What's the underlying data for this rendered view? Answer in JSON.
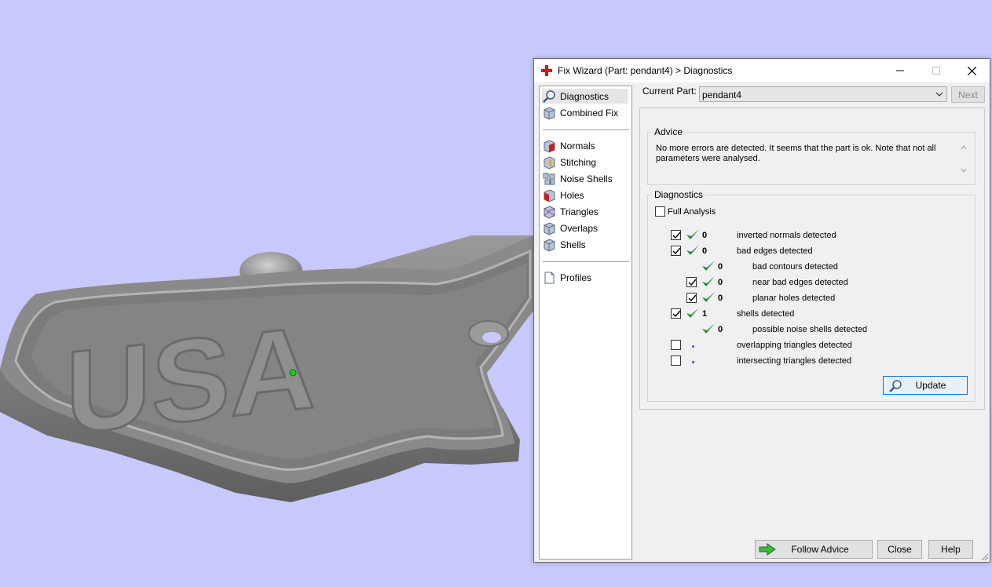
{
  "window": {
    "title": "Fix Wizard (Part: pendant4) > Diagnostics"
  },
  "viewport": {
    "model_text": "USA"
  },
  "nav": {
    "items": [
      {
        "label": "Diagnostics",
        "icon": "magnifier-icon"
      },
      {
        "label": "Combined Fix",
        "icon": "cube-icon"
      },
      {
        "label": "Normals",
        "icon": "normals-cube-icon"
      },
      {
        "label": "Stitching",
        "icon": "stitching-cube-icon"
      },
      {
        "label": "Noise Shells",
        "icon": "noise-shells-icon"
      },
      {
        "label": "Holes",
        "icon": "holes-cube-icon"
      },
      {
        "label": "Triangles",
        "icon": "triangles-cube-icon"
      },
      {
        "label": "Overlaps",
        "icon": "overlaps-cube-icon"
      },
      {
        "label": "Shells",
        "icon": "shells-cube-icon"
      },
      {
        "label": "Profiles",
        "icon": "document-icon"
      }
    ]
  },
  "part": {
    "label": "Current Part:",
    "value": "pendant4",
    "next_label": "Next"
  },
  "advice": {
    "title": "Advice",
    "text": "No more errors are detected. It seems that the part is ok. Note that not all parameters were analysed."
  },
  "diagnostics": {
    "title": "Diagnostics",
    "full_analysis_label": "Full Analysis",
    "full_analysis_checked": false,
    "rows": [
      {
        "checkbox": true,
        "checked": true,
        "status": "ok",
        "count": "0",
        "label": "inverted normals detected"
      },
      {
        "checkbox": true,
        "checked": true,
        "status": "ok",
        "count": "0",
        "label": "bad edges detected"
      },
      {
        "checkbox": false,
        "checked": false,
        "status": "ok",
        "count": "0",
        "label": "bad contours detected"
      },
      {
        "checkbox": true,
        "checked": true,
        "status": "ok",
        "count": "0",
        "label": "near bad edges detected"
      },
      {
        "checkbox": true,
        "checked": true,
        "status": "ok",
        "count": "0",
        "label": "planar holes detected"
      },
      {
        "checkbox": true,
        "checked": true,
        "status": "ok",
        "count": "1",
        "label": "shells detected"
      },
      {
        "checkbox": false,
        "checked": false,
        "status": "ok",
        "count": "0",
        "label": "possible noise shells detected"
      },
      {
        "checkbox": true,
        "checked": false,
        "status": "pending",
        "count": "",
        "label": "overlapping triangles detected"
      },
      {
        "checkbox": true,
        "checked": false,
        "status": "pending",
        "count": "",
        "label": "intersecting triangles detected"
      }
    ],
    "update_label": "Update"
  },
  "footer": {
    "follow_advice_label": "Follow Advice",
    "close_label": "Close",
    "help_label": "Help"
  },
  "colors": {
    "background": "#c8c8fc",
    "model": "#8c8c8c",
    "ok_tick": "#1e8f2e",
    "accent": "#0078d7"
  }
}
